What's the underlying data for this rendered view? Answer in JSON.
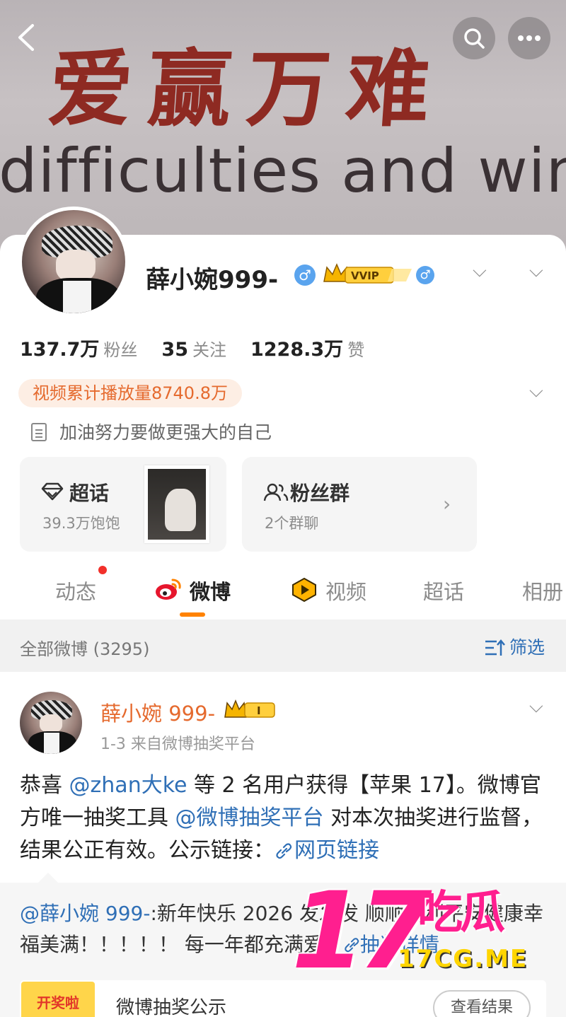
{
  "cover": {
    "line1": "爱赢万难",
    "line2": "difficulties and wins"
  },
  "profile": {
    "name": "薛小婉999-",
    "vip_label": "VVIP",
    "stats": [
      {
        "value": "137.7万",
        "label": "粉丝"
      },
      {
        "value": "35",
        "label": "关注"
      },
      {
        "value": "1228.3万",
        "label": "赞"
      }
    ],
    "play_count": "视频累计播放量8740.8万",
    "bio": "加油努力要做更强大的自己"
  },
  "tiles": {
    "supertopic": {
      "title": "超话",
      "sub": "39.3万饱饱"
    },
    "fangroup": {
      "title": "粉丝群",
      "sub": "2个群聊"
    }
  },
  "tabs": [
    "动态",
    "微博",
    "视频",
    "超话",
    "相册"
  ],
  "filter": {
    "left": "全部微博 (3295)",
    "right": "筛选"
  },
  "post": {
    "author": "薛小婉 999-",
    "badge": "I",
    "meta": "1-3  来自微博抽奖平台",
    "t1": "恭喜 ",
    "mention1": "@zhan大ke",
    "t2": " 等 2 名用户获得【苹果 17】。微博官方唯一抽奖工具 ",
    "mention2": "@微博抽奖平台",
    "t3": " 对本次抽奖进行监督，结果公正有效。公示链接：",
    "web_link": "网页链接"
  },
  "repost": {
    "mention": "@薛小婉 999-",
    "text": ":新年快乐 2026 发发发 顺顺利利平安健康幸福美满！！！！！ 每一年都充满爱！",
    "link": "抽奖详情",
    "card_thumb": "开奖啦",
    "card_title": "微博抽奖公示",
    "card_button": "查看结果"
  },
  "watermark": {
    "num": "17",
    "cn": "吃瓜",
    "en": "17CG.ME"
  },
  "colors": {
    "accent": "#ff8200",
    "link": "#2f6fb6",
    "author": "#e56a2e",
    "watermark": "#ff1f8f"
  }
}
